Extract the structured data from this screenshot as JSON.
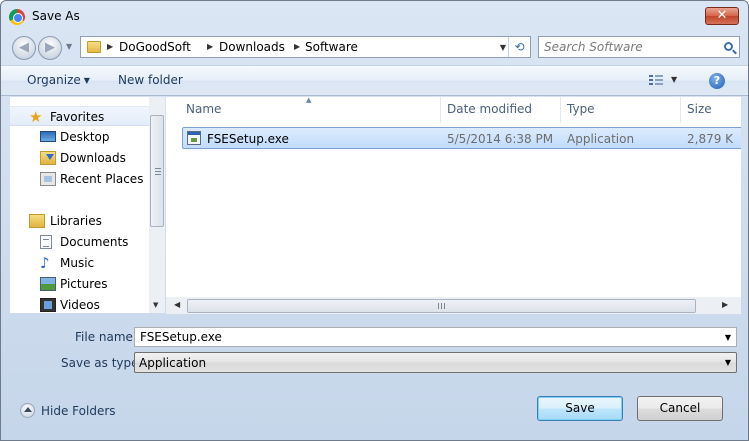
{
  "window": {
    "title": "Save As",
    "close_label": "✕"
  },
  "nav": {
    "back_glyph": "◀",
    "forward_glyph": "▶"
  },
  "address": {
    "crumbs": [
      "DoGoodSoft",
      "Downloads",
      "Software"
    ],
    "refresh_glyph": "⟲"
  },
  "search": {
    "placeholder": "Search Software"
  },
  "toolbar": {
    "organize_label": "Organize",
    "new_folder_label": "New folder",
    "help_label": "?"
  },
  "sidebar": {
    "items": [
      {
        "label": "Favorites",
        "icon": "star-icon"
      },
      {
        "label": "Desktop",
        "icon": "desktop-icon"
      },
      {
        "label": "Downloads",
        "icon": "downloads-icon"
      },
      {
        "label": "Recent Places",
        "icon": "recent-places-icon"
      },
      {
        "label": "Libraries",
        "icon": "libraries-icon"
      },
      {
        "label": "Documents",
        "icon": "documents-icon"
      },
      {
        "label": "Music",
        "icon": "music-icon"
      },
      {
        "label": "Pictures",
        "icon": "pictures-icon"
      },
      {
        "label": "Videos",
        "icon": "videos-icon"
      }
    ]
  },
  "filelist": {
    "columns": [
      "Name",
      "Date modified",
      "Type",
      "Size"
    ],
    "rows": [
      {
        "name": "FSESetup.exe",
        "date": "5/5/2014 6:38 PM",
        "type": "Application",
        "size": "2,879 K"
      }
    ]
  },
  "form": {
    "filename_label": "File name:",
    "filename_value": "FSESetup.exe",
    "savetype_label": "Save as type:",
    "savetype_value": "Application"
  },
  "footer": {
    "hide_folders_label": "Hide Folders",
    "save_label": "Save",
    "cancel_label": "Cancel"
  },
  "colors": {
    "selection": "#c2dcfd",
    "accent": "#1e395b",
    "close": "#c0442a"
  }
}
